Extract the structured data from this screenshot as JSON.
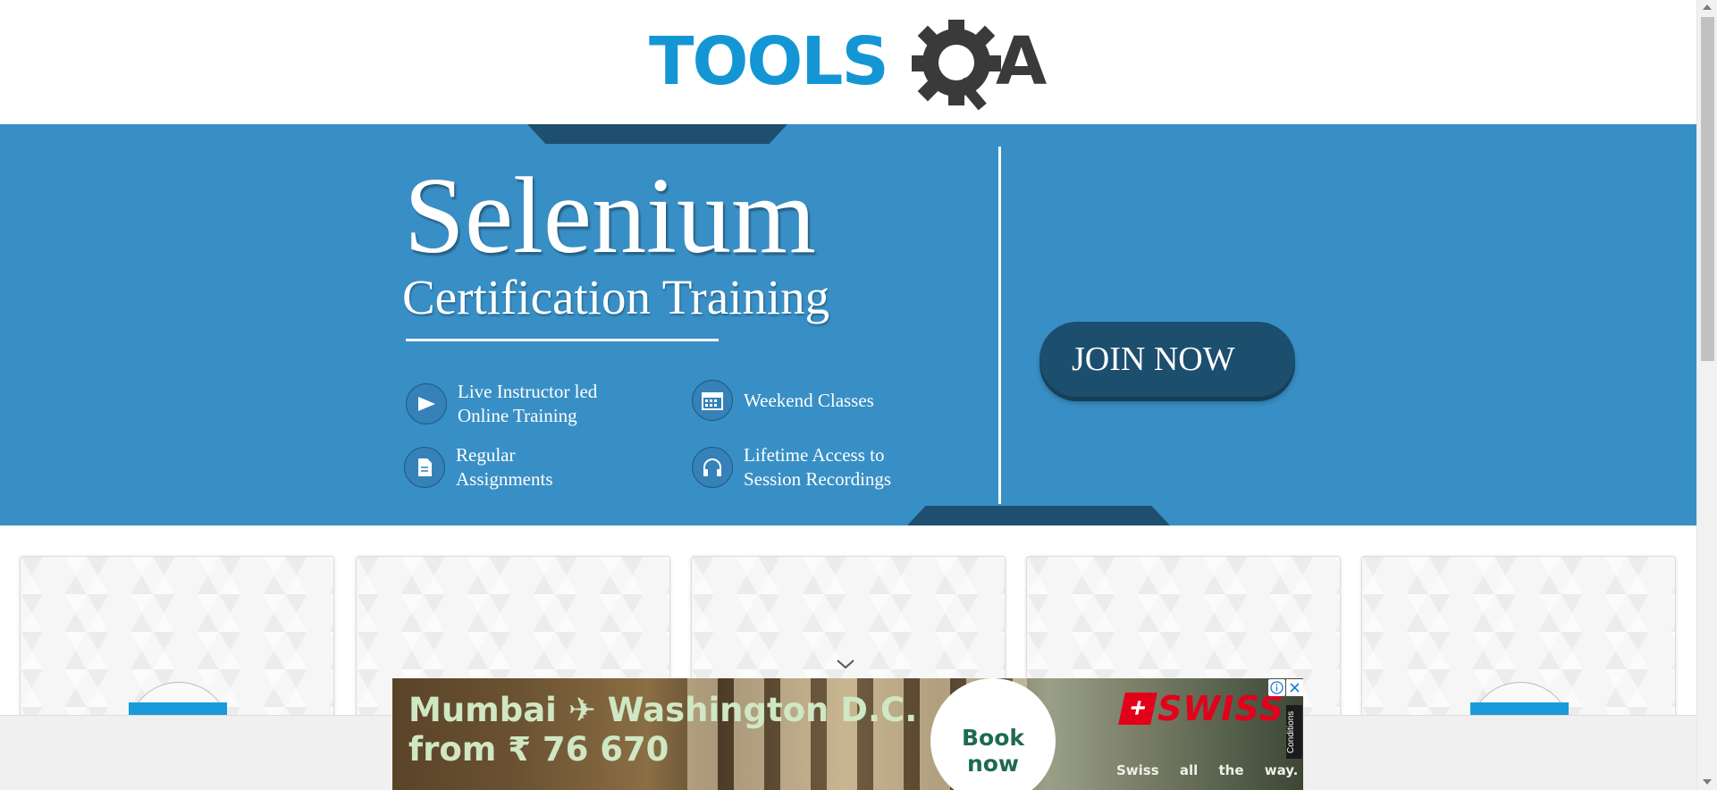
{
  "header": {
    "logo_text_left": "TOOLS",
    "logo_text_right": "A",
    "logo_colors": {
      "tools": "#1496d5",
      "qa": "#3a3a3a"
    }
  },
  "banner": {
    "title": "Selenium",
    "subtitle": "Certification Training",
    "features": [
      {
        "icon": "play-icon",
        "line1": "Live Instructor led",
        "line2": "Online Training"
      },
      {
        "icon": "calendar-icon",
        "line1": "Weekend Classes",
        "line2": ""
      },
      {
        "icon": "document-icon",
        "line1": "Regular",
        "line2": "Assignments"
      },
      {
        "icon": "headphones-icon",
        "line1": "Lifetime Access to",
        "line2": "Session Recordings"
      }
    ],
    "cta_label": "JOIN NOW",
    "colors": {
      "background": "#388fc6",
      "accent_dark": "#1f4f6e"
    }
  },
  "cards": {
    "count": 5,
    "accent_color": "#1a9ad9"
  },
  "ad": {
    "line1": "Mumbai ✈ Washington D.C.",
    "line2": "from ₹ 76 670",
    "book_label_1": "Book",
    "book_label_2": "now",
    "brand": "SWISS",
    "tagline": "Swiss all the way.",
    "conditions": "Conditions"
  }
}
